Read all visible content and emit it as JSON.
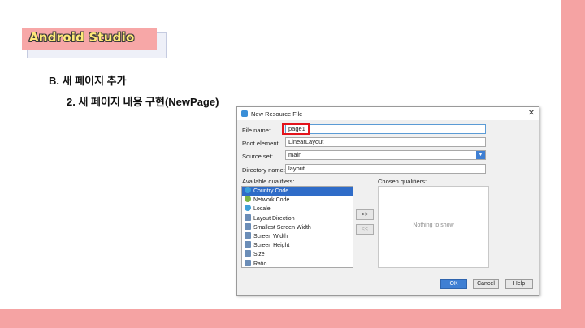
{
  "slide": {
    "badge_title": "Android Studio",
    "heading": "B. 새 페이지 추가",
    "subheading": "2. 새 페이지 내용 구현(NewPage)"
  },
  "dialog": {
    "title": "New Resource File",
    "fields": {
      "file_name": {
        "label": "File name:",
        "value": "page1"
      },
      "root_element": {
        "label": "Root element:",
        "value": "LinearLayout"
      },
      "source_set": {
        "label": "Source set:",
        "value": "main"
      },
      "directory_name": {
        "label": "Directory name:",
        "value": "layout"
      }
    },
    "available_label": "Available qualifiers:",
    "chosen_label": "Chosen qualifiers:",
    "qualifiers": [
      {
        "label": "Country Code",
        "icon": "globe-icon",
        "selected": true
      },
      {
        "label": "Network Code",
        "icon": "network-icon"
      },
      {
        "label": "Locale",
        "icon": "locale-icon"
      },
      {
        "label": "Layout Direction",
        "icon": "layout-direction-icon"
      },
      {
        "label": "Smallest Screen Width",
        "icon": "screen-width-icon"
      },
      {
        "label": "Screen Width",
        "icon": "screen-width-icon"
      },
      {
        "label": "Screen Height",
        "icon": "screen-height-icon"
      },
      {
        "label": "Size",
        "icon": "size-icon"
      },
      {
        "label": "Ratio",
        "icon": "ratio-icon"
      }
    ],
    "add_button": ">>",
    "remove_button": "<<",
    "chosen_empty": "Nothing to show",
    "buttons": {
      "ok": "OK",
      "cancel": "Cancel",
      "help": "Help"
    }
  },
  "colors": {
    "accent": "#3f7fd3",
    "highlight": "#e3141c",
    "slide_pink": "#f5a3a3",
    "badge_text": "#ffe978"
  }
}
